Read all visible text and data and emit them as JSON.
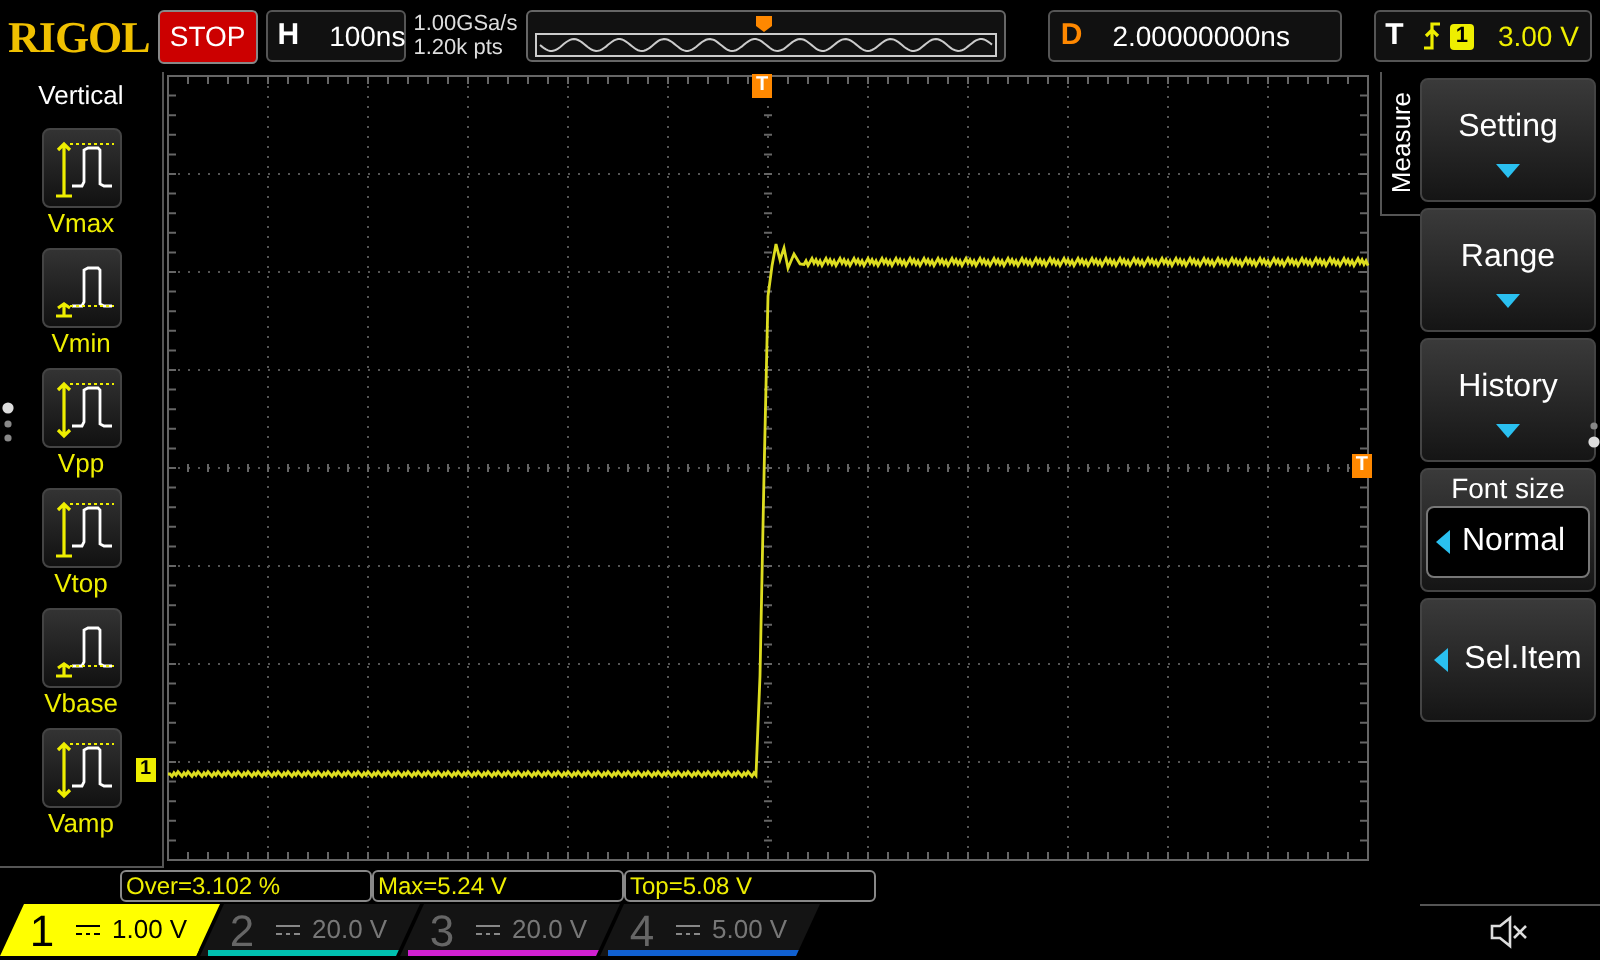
{
  "header": {
    "logo": "RIGOL",
    "run_state": "STOP",
    "timebase_label": "H",
    "timebase": "100ns",
    "sample_rate": "1.00GSa/s",
    "memory_depth": "1.20k pts",
    "delay_label": "D",
    "delay": "2.00000000ns",
    "trigger_label": "T",
    "trigger_source": "1",
    "trigger_level": "3.00 V"
  },
  "sidebar": {
    "title": "Vertical",
    "items": [
      {
        "kind": "vmax",
        "label": "Vmax"
      },
      {
        "kind": "vmin",
        "label": "Vmin"
      },
      {
        "kind": "vpp",
        "label": "Vpp"
      },
      {
        "kind": "vtop",
        "label": "Vtop"
      },
      {
        "kind": "vbase",
        "label": "Vbase"
      },
      {
        "kind": "vamp",
        "label": "Vamp"
      }
    ]
  },
  "screen": {
    "trigger_marker": "T",
    "level_marker": "T",
    "channel_marker": "1"
  },
  "measurements": [
    "Over=3.102 %",
    "Max=5.24 V",
    "Top=5.08 V"
  ],
  "menu": {
    "title": "Measure",
    "items": [
      {
        "kind": "submenu",
        "label": "Setting"
      },
      {
        "kind": "submenu",
        "label": "Range"
      },
      {
        "kind": "submenu",
        "label": "History"
      },
      {
        "kind": "option",
        "label": "Font size",
        "value": "Normal"
      },
      {
        "kind": "action",
        "label": "Sel.Item"
      }
    ]
  },
  "channels": [
    {
      "number": "1",
      "scale": "1.00 V",
      "selected": true,
      "color": "#ffff00"
    },
    {
      "number": "2",
      "scale": "20.0 V",
      "selected": false,
      "color": "#00c0b0"
    },
    {
      "number": "3",
      "scale": "20.0 V",
      "selected": false,
      "color": "#d020d0"
    },
    {
      "number": "4",
      "scale": "5.00 V",
      "selected": false,
      "color": "#1060d0"
    }
  ]
}
